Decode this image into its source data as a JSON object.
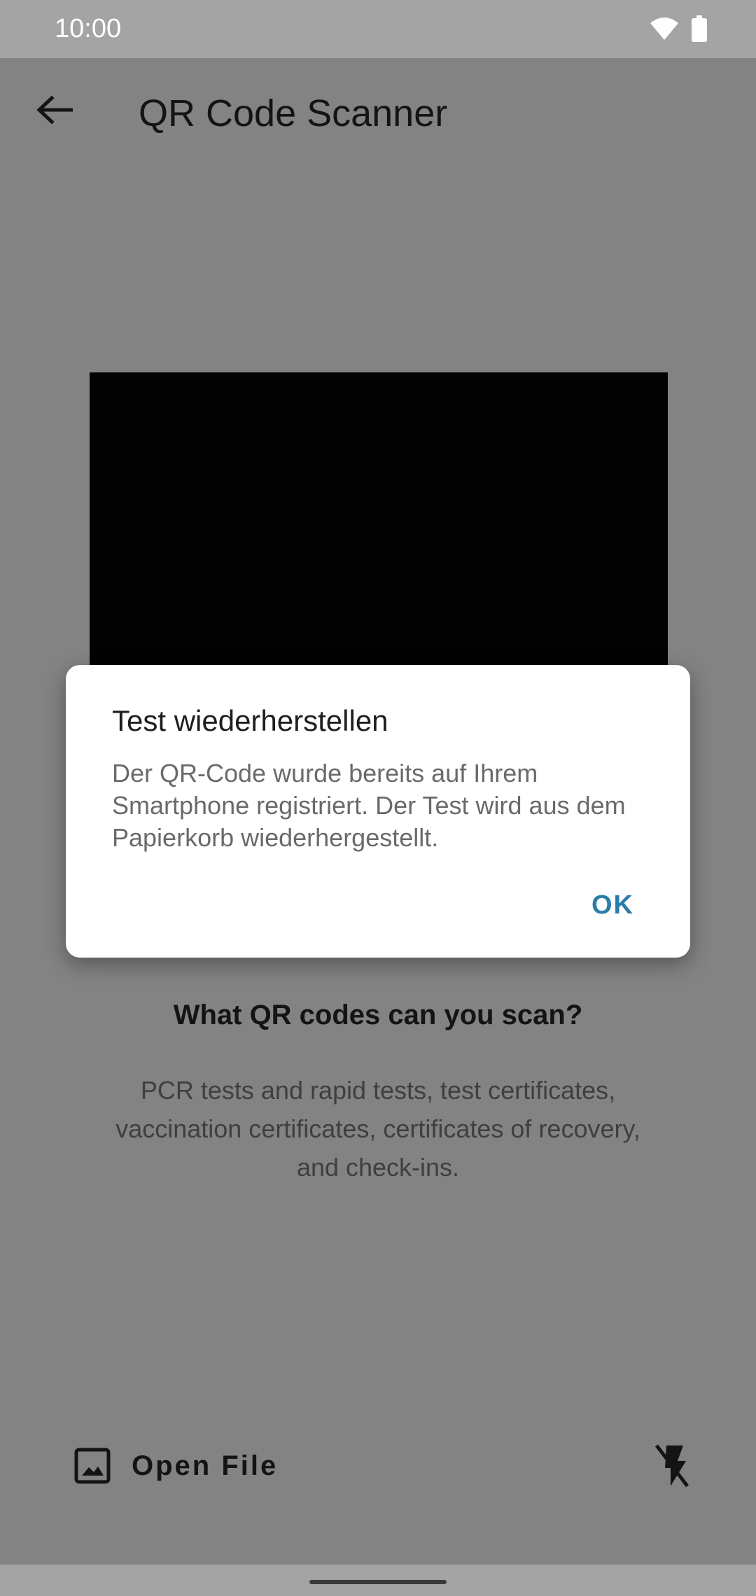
{
  "status_bar": {
    "time": "10:00",
    "icons": [
      "wifi-icon",
      "battery-icon"
    ]
  },
  "app_bar": {
    "title": "QR Code Scanner",
    "back_icon": "arrow-back-icon"
  },
  "scanner": {
    "info_title": "What QR codes can you scan?",
    "info_body": "PCR tests and rapid tests, test certificates, vaccination certificates, certificates of recovery, and check-ins."
  },
  "bottom": {
    "open_file_label": "Open File",
    "open_file_icon": "image-icon",
    "flash_icon": "flash-off-icon"
  },
  "dialog": {
    "title": "Test wiederherstellen",
    "message": "Der QR-Code wurde bereits auf Ihrem Smartphone registriert.  Der Test wird aus dem Papierkorb wiederhergestellt.",
    "ok_label": "OK"
  },
  "colors": {
    "accent": "#2b7ca9",
    "scrim_background": "#838383",
    "status_bar": "#a4a4a4"
  }
}
